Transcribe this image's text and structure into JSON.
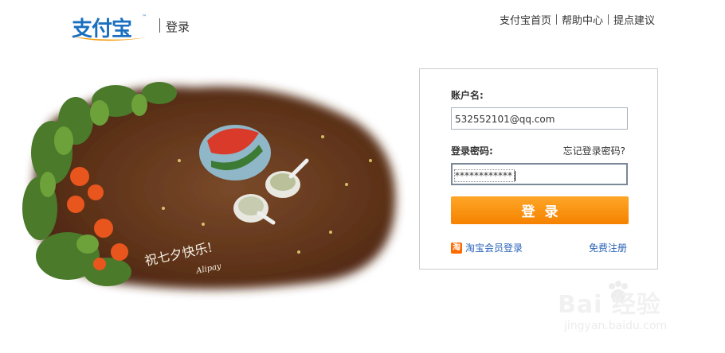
{
  "header": {
    "logo_text": "支付宝",
    "logo_tm": "™",
    "page_title": "登录",
    "links": [
      "支付宝首页",
      "帮助中心",
      "提点建议"
    ]
  },
  "hero": {
    "caption": "祝七夕快乐!",
    "signature": "Alipay"
  },
  "login": {
    "account_label": "账户名:",
    "account_value": "532552101@qq.com",
    "password_label": "登录密码:",
    "forgot_link": "忘记登录密码?",
    "password_value": "************",
    "submit_label": "登录",
    "taobao_icon_char": "淘",
    "taobao_link": "淘宝会员登录",
    "register_link": "免费注册"
  },
  "watermark": {
    "text": "Bai 经验",
    "url": "jingyan.baidu.com"
  },
  "colors": {
    "brand_blue": "#1a6fc0",
    "button_orange": "#f58200",
    "link_blue": "#2a63b8"
  }
}
